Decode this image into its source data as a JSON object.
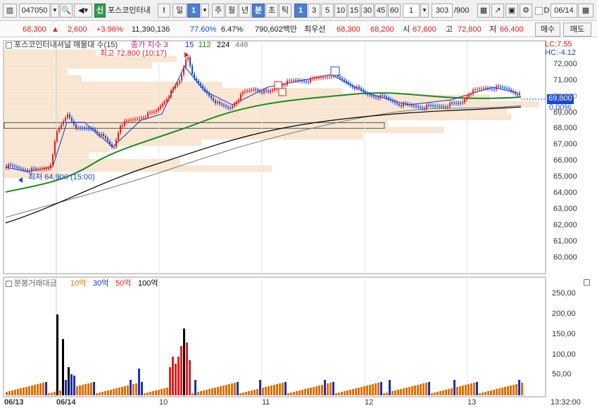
{
  "toolbar": {
    "code": "047050",
    "badge": "신",
    "name": "포스코인터내",
    "warn": "!",
    "period_buttons": [
      "일",
      "1",
      "주",
      "월",
      "년",
      "분",
      "초",
      "틱"
    ],
    "minute_buttons": [
      "1",
      "3",
      "5",
      "10",
      "15",
      "30",
      "45",
      "60"
    ],
    "interval_value": "1",
    "count_value": "303",
    "count_total": "/900",
    "date_label": "D",
    "date_value": "06/14"
  },
  "quote": {
    "price": "68,300",
    "arrow": "▲",
    "change": "2,600",
    "change_pct": "+3.96%",
    "volume": "11,390,136",
    "volume_ratio": "77.60%",
    "turnover": "6.47%",
    "amount": "790,602백만",
    "best_label": "최우선",
    "ask": "68,300",
    "bid": "68,200",
    "open_label": "시",
    "open": "67,600",
    "high_label": "고",
    "high": "72,800",
    "low_label": "저",
    "low": "66,400",
    "buy_label": "매수",
    "sell_label": "매도"
  },
  "main_panel": {
    "title": "포스코인터내셔널 매물대 수(15)",
    "ma_title": "종가 지수 3",
    "ma_periods": [
      "15",
      "112",
      "224",
      "448"
    ],
    "ma_colors": [
      "#1a2fbf",
      "#1a8a1a",
      "#000000",
      "#555555"
    ],
    "lc": "LC:7.55",
    "hc": "HC:-4.12",
    "high_marker": "최고 72,800 (10:17)",
    "low_marker": "최저 64,900 (15:00)",
    "current_price": "69,800",
    "current_pct": "0.00%",
    "y_ticks": [
      "72,000",
      "71,000",
      "70,000",
      "69,000",
      "68,000",
      "67,000",
      "66,000",
      "65,000",
      "64,000",
      "63,000",
      "62,000",
      "61,000",
      "60,000"
    ]
  },
  "volume_panel": {
    "title": "분봉거래대금",
    "legend": [
      {
        "label": "10억",
        "color": "#e07000"
      },
      {
        "label": "30억",
        "color": "#1a2fbf"
      },
      {
        "label": "50억",
        "color": "#e02020"
      },
      {
        "label": "100억",
        "color": "#000000"
      }
    ],
    "y_ticks": [
      "250,00",
      "200,00",
      "150,00",
      "100,00",
      "50,00"
    ]
  },
  "x_axis": {
    "labels": [
      "06/13",
      "06/14",
      "10",
      "11",
      "12",
      "13"
    ],
    "time": "13:32:00"
  },
  "colors": {
    "up": "#e02020",
    "down": "#1a47d8",
    "volume_profile": "#f8e6d2"
  }
}
